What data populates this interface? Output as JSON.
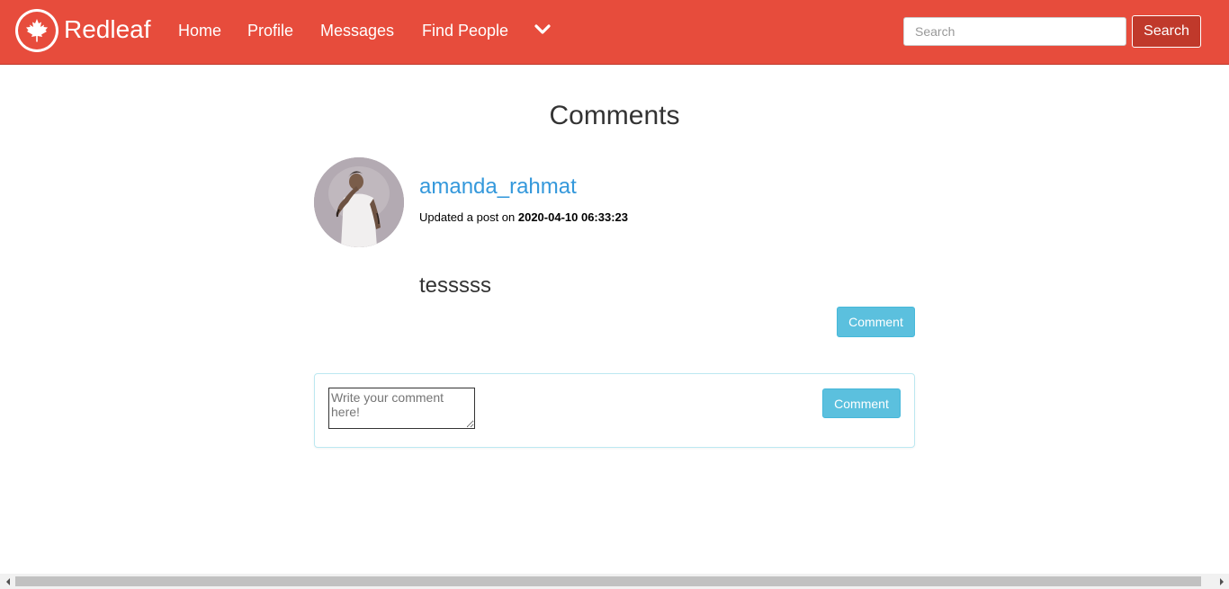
{
  "brand": {
    "name": "Redleaf",
    "logo_icon": "maple-leaf-icon"
  },
  "nav": {
    "items": [
      {
        "label": "Home"
      },
      {
        "label": "Profile"
      },
      {
        "label": "Messages"
      },
      {
        "label": "Find People"
      }
    ],
    "more_icon": "chevron-down-icon"
  },
  "search": {
    "placeholder": "Search",
    "button_label": "Search"
  },
  "page": {
    "title": "Comments"
  },
  "post": {
    "username": "amanda_rahmat",
    "meta_prefix": "Updated a post on ",
    "timestamp": "2020-04-10 06:33:23",
    "text": "tesssss",
    "comment_button": "Comment"
  },
  "comment_form": {
    "placeholder": "Write your comment here!",
    "submit_label": "Comment"
  },
  "colors": {
    "navbar": "#e74c3c",
    "search_button": "#c0392b",
    "link": "#3498db",
    "info_button": "#5bc0de"
  }
}
